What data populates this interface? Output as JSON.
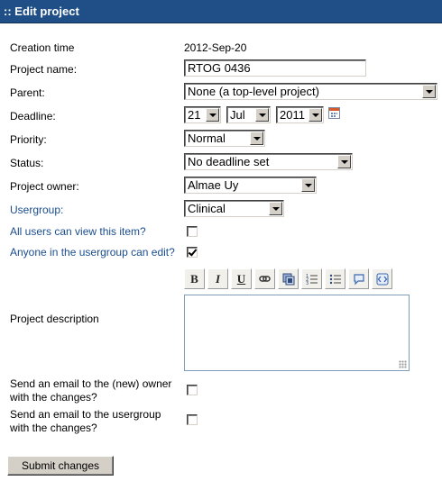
{
  "header": {
    "title": ":: Edit project"
  },
  "form": {
    "creation_time": {
      "label": "Creation time",
      "value": "2012-Sep-20"
    },
    "project_name": {
      "label": "Project name:",
      "value": "RTOG 0436"
    },
    "parent": {
      "label": "Parent:",
      "value": "None (a top-level project)"
    },
    "deadline": {
      "label": "Deadline:",
      "day": "21",
      "month": "Jul",
      "year": "2011",
      "icon": "calendar-icon"
    },
    "priority": {
      "label": "Priority:",
      "value": "Normal"
    },
    "status": {
      "label": "Status:",
      "value": "No deadline set"
    },
    "project_owner": {
      "label": "Project owner:",
      "value": "Almae Uy"
    },
    "usergroup": {
      "label": "Usergroup:",
      "value": "Clinical"
    },
    "all_users_view": {
      "label": "All users can view this item?",
      "checked": false
    },
    "usergroup_edit": {
      "label": "Anyone in the usergroup can edit?",
      "checked": true
    },
    "description": {
      "label": "Project description",
      "value": "",
      "toolbar": [
        {
          "name": "bold-button",
          "glyph": "B"
        },
        {
          "name": "italic-button",
          "glyph": "I"
        },
        {
          "name": "underline-button",
          "glyph": "U"
        },
        {
          "name": "link-button",
          "icon": "link-icon"
        },
        {
          "name": "image-button",
          "icon": "image-icon"
        },
        {
          "name": "ordered-list-button",
          "icon": "ordered-list-icon"
        },
        {
          "name": "unordered-list-button",
          "icon": "unordered-list-icon"
        },
        {
          "name": "quote-button",
          "icon": "speech-bubble-icon"
        },
        {
          "name": "code-button",
          "icon": "code-icon"
        }
      ]
    },
    "email_owner": {
      "label_line1": "Send an email to the (new) owner",
      "label_line2": "with the changes?",
      "checked": false
    },
    "email_usergroup": {
      "label_line1": "Send an email to the usergroup",
      "label_line2": "with the changes?",
      "checked": false
    },
    "submit_label": "Submit changes"
  },
  "colors": {
    "header_bg": "#1f4f86",
    "link_label": "#1a4d8f"
  }
}
